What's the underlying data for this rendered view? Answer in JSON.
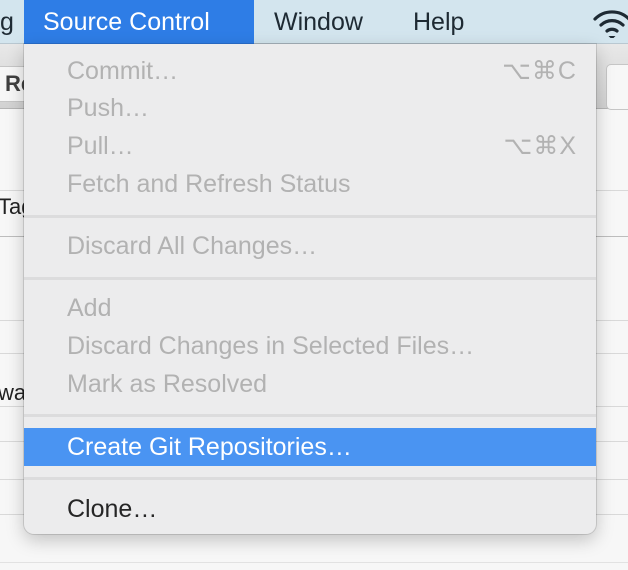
{
  "menubar": {
    "items": [
      {
        "label": "g"
      },
      {
        "label": "Source Control"
      },
      {
        "label": "Window"
      },
      {
        "label": "Help"
      }
    ],
    "status_icons": [
      "wifi-icon"
    ],
    "colors": {
      "bar": "#d3e5ee",
      "active": "#2e7de6"
    }
  },
  "background_window": {
    "toolbar_button_label": "Re",
    "row_texts": [
      "Tag",
      "wa"
    ]
  },
  "menu": {
    "title": "Source Control",
    "groups": [
      [
        {
          "label": "Commit…",
          "shortcut": "⌥⌘C",
          "enabled": false
        },
        {
          "label": "Push…",
          "shortcut": "",
          "enabled": false
        },
        {
          "label": "Pull…",
          "shortcut": "⌥⌘X",
          "enabled": false
        },
        {
          "label": "Fetch and Refresh Status",
          "shortcut": "",
          "enabled": false
        }
      ],
      [
        {
          "label": "Discard All Changes…",
          "shortcut": "",
          "enabled": false
        }
      ],
      [
        {
          "label": "Add",
          "shortcut": "",
          "enabled": false
        },
        {
          "label": "Discard Changes in Selected Files…",
          "shortcut": "",
          "enabled": false
        },
        {
          "label": "Mark as Resolved",
          "shortcut": "",
          "enabled": false
        }
      ],
      [
        {
          "label": "Create Git Repositories…",
          "shortcut": "",
          "enabled": true,
          "highlighted": true
        }
      ],
      [
        {
          "label": "Clone…",
          "shortcut": "",
          "enabled": true
        }
      ]
    ],
    "colors": {
      "highlight": "#4a94f2",
      "disabled_text": "#b2b2b2",
      "background": "#ececed"
    }
  }
}
